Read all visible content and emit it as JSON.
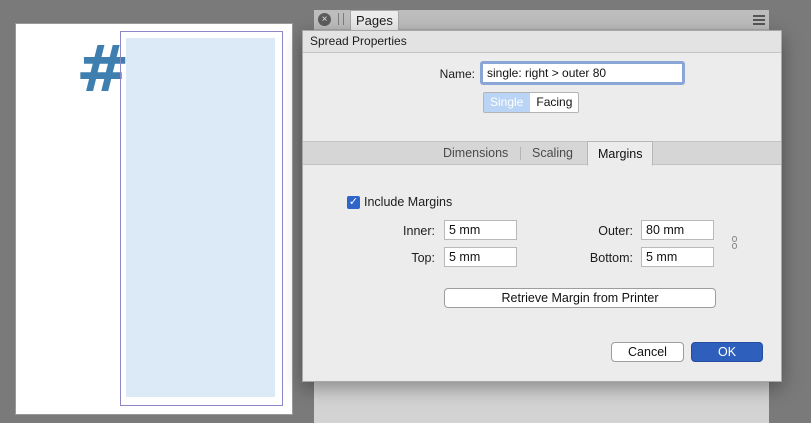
{
  "canvas": {
    "page_number_glyph": "#"
  },
  "pages_panel": {
    "tab_label": "Pages",
    "close_icon": "×"
  },
  "dialog": {
    "title": "Spread Properties",
    "name_label": "Name:",
    "name_value": "single: right > outer 80",
    "layout_options": {
      "single": "Single",
      "facing": "Facing",
      "selected": "Single"
    },
    "tabs": [
      {
        "label": "Dimensions",
        "active": false
      },
      {
        "label": "Scaling",
        "active": false
      },
      {
        "label": "Margins",
        "active": true
      }
    ],
    "margins": {
      "include_label": "Include Margins",
      "include_checked": true,
      "check_mark": "✓",
      "inner": {
        "label": "Inner:",
        "value": "5 mm"
      },
      "top": {
        "label": "Top:",
        "value": "5 mm"
      },
      "outer": {
        "label": "Outer:",
        "value": "80 mm"
      },
      "bottom": {
        "label": "Bottom:",
        "value": "5 mm"
      },
      "retrieve_button": "Retrieve Margin from Printer"
    },
    "cancel_label": "Cancel",
    "ok_label": "OK"
  },
  "colors": {
    "ok_button": "#2e5fbd",
    "selected_segment": "#b9d4f4",
    "page_content": "#dce9f6",
    "page_number": "#3f7fb0"
  }
}
